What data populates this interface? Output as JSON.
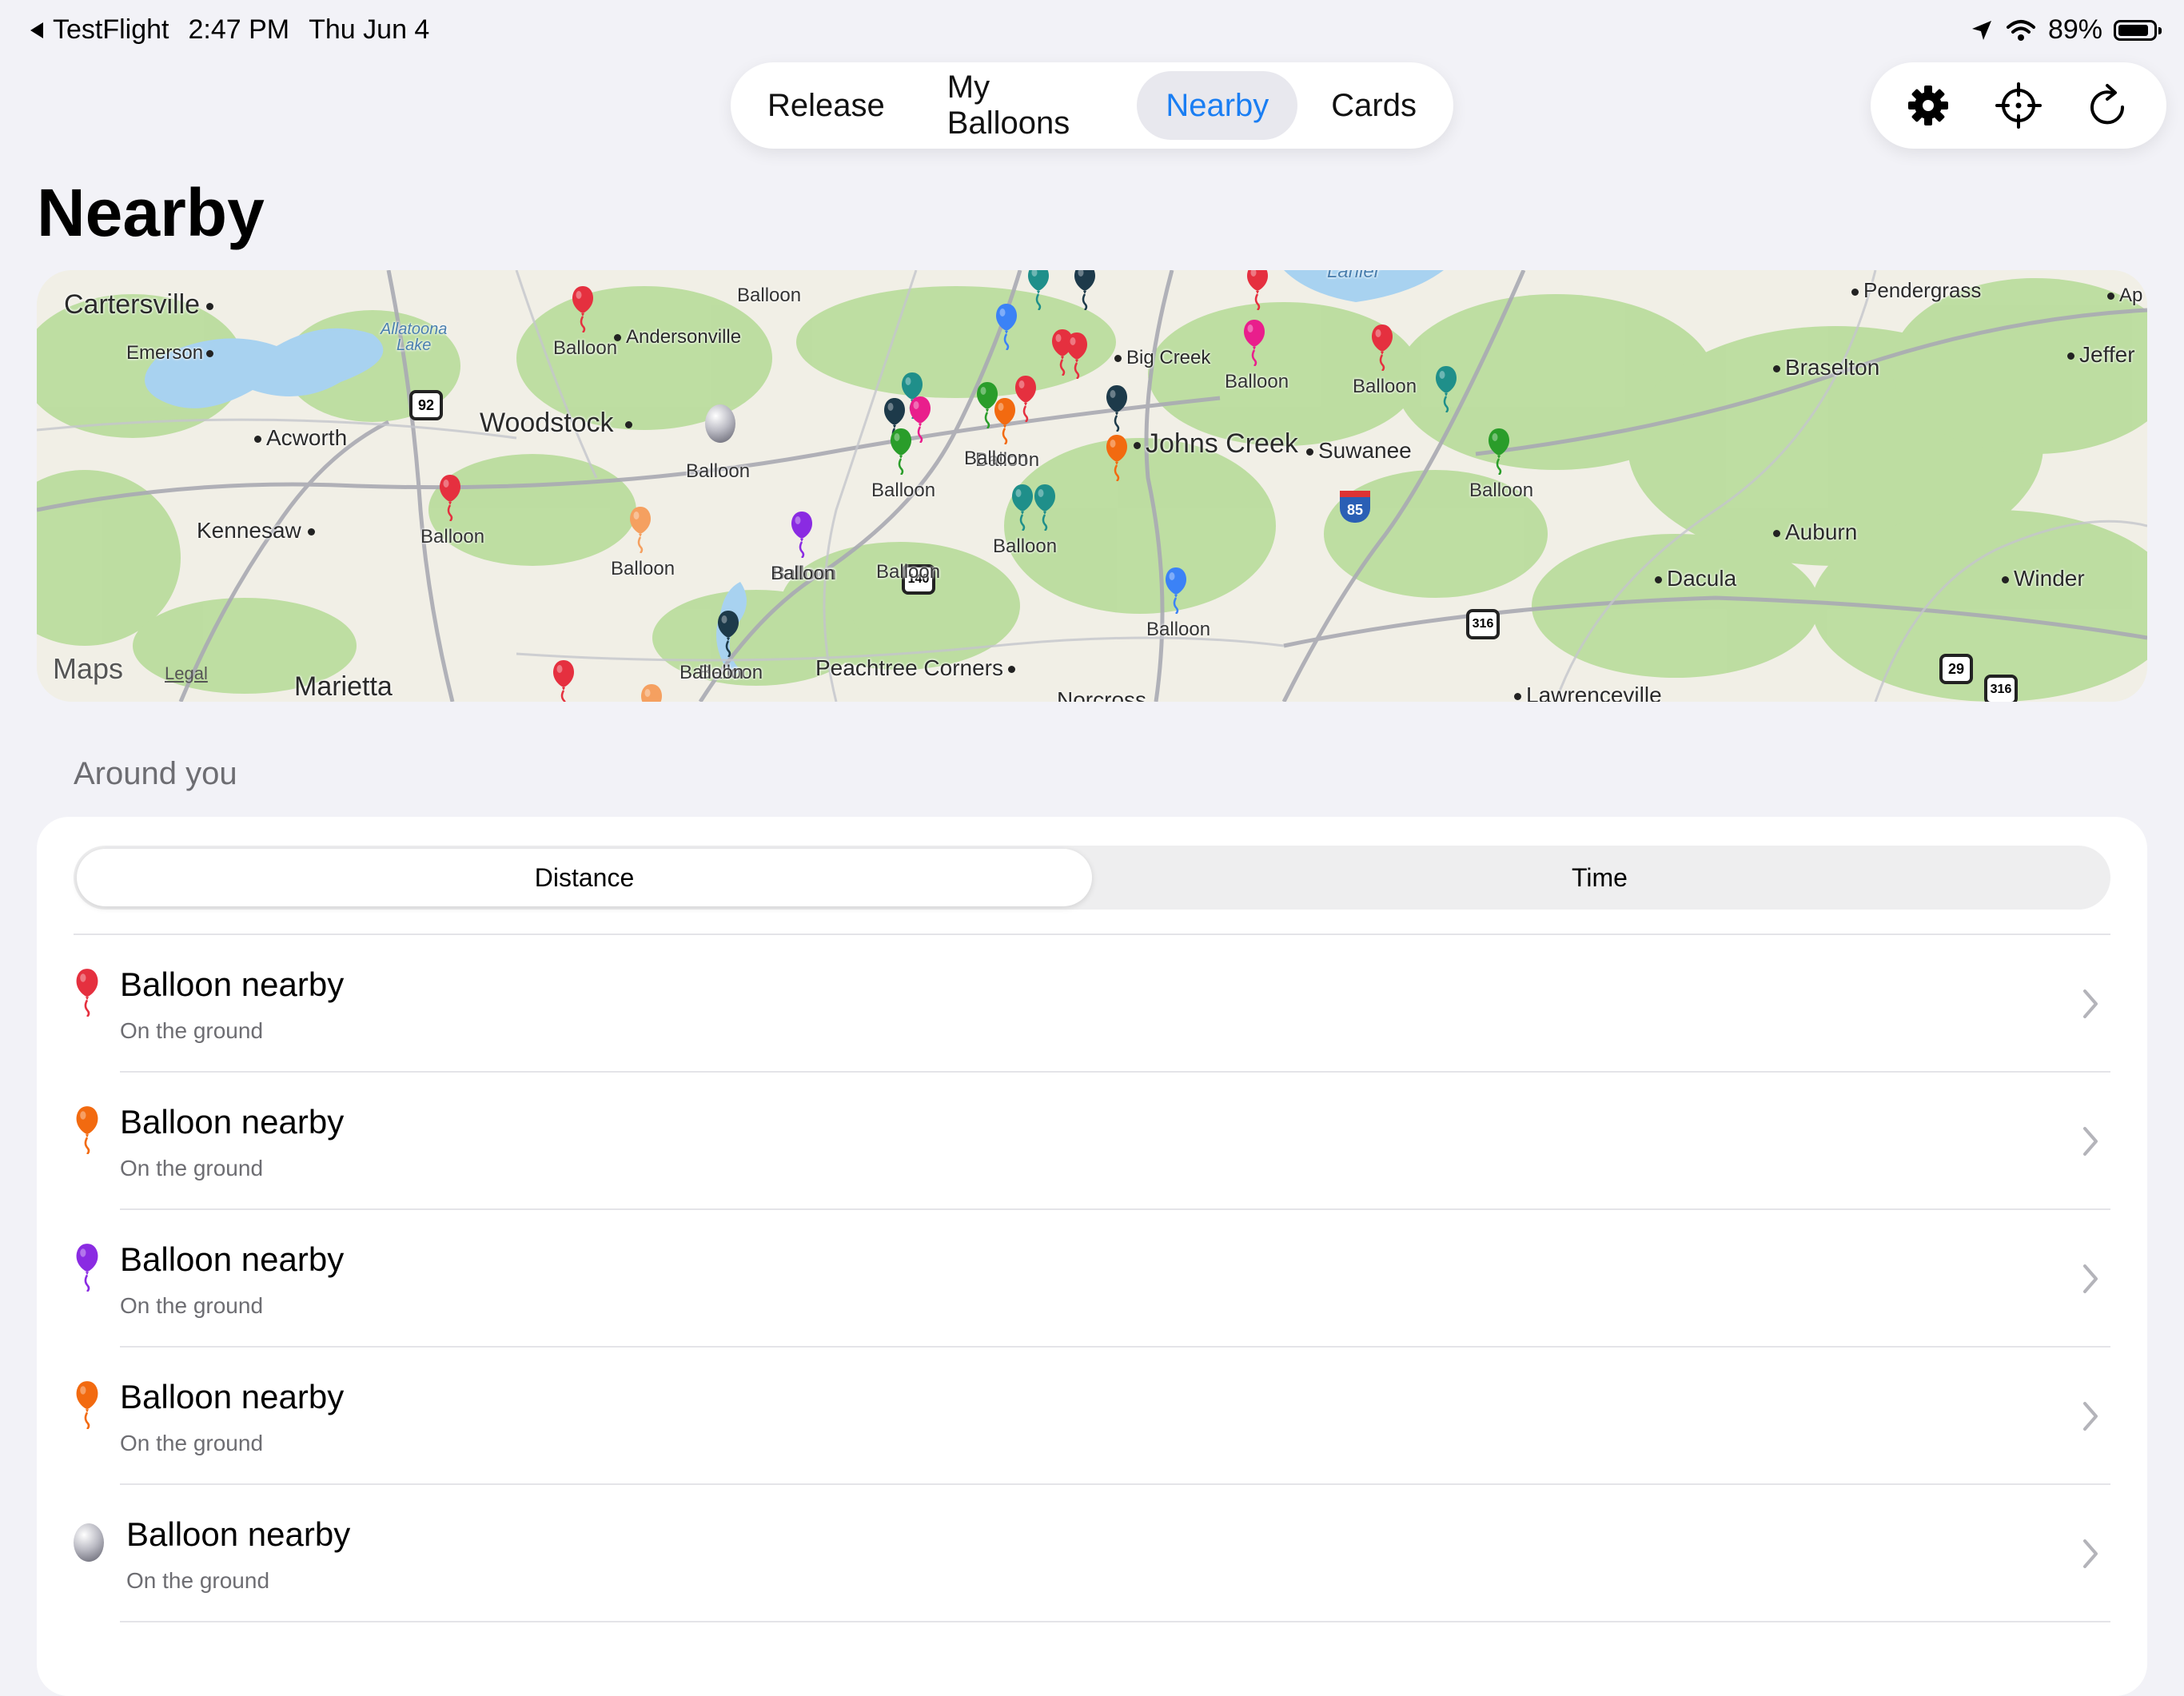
{
  "status_bar": {
    "back_app": "TestFlight",
    "time": "2:47 PM",
    "date": "Thu Jun 4",
    "battery": "89%",
    "battery_level": 0.89
  },
  "tabs": {
    "items": [
      "Release",
      "My Balloons",
      "Nearby",
      "Cards"
    ],
    "active": "Nearby"
  },
  "toolbar": {
    "settings_icon": "gear-icon",
    "locate_icon": "crosshair-icon",
    "refresh_icon": "refresh-icon"
  },
  "page": {
    "title": "Nearby"
  },
  "map": {
    "places": {
      "cartersville": "Cartersville",
      "emerson": "Emerson",
      "allatoona": "Allatoona\nLake",
      "andersonville": "Andersonville",
      "woodstock": "Woodstock",
      "acworth": "Acworth",
      "kennesaw": "Kennesaw",
      "marietta": "Marietta",
      "big_creek": "Big Creek",
      "johns_creek": "Johns Creek",
      "suwanee": "Suwanee",
      "pendergrass": "Pendergrass",
      "braselton": "Braselton",
      "jefferson": "Jeffer",
      "ap": "Ap",
      "auburn": "Auburn",
      "dacula": "Dacula",
      "winder": "Winder",
      "peachtree_corners": "Peachtree Corners",
      "lanier": "Lanier",
      "norcross": "Norcross",
      "lawrenceville": "Lawrenceville"
    },
    "balloon_label": "Balloon",
    "shields": {
      "s92": "92",
      "s140": "140",
      "s316a": "316",
      "s316b": "316",
      "s29": "29",
      "i85": "85"
    },
    "logo": "Maps",
    "legal": "Legal"
  },
  "list": {
    "section_label": "Around you",
    "sort_options": [
      "Distance",
      "Time"
    ],
    "selected_sort": "Distance",
    "items": [
      {
        "title": "Balloon nearby",
        "subtitle": "On the ground",
        "color": "#e5303f"
      },
      {
        "title": "Balloon nearby",
        "subtitle": "On the ground",
        "color": "#f26a10"
      },
      {
        "title": "Balloon nearby",
        "subtitle": "On the ground",
        "color": "#8a2be2"
      },
      {
        "title": "Balloon nearby",
        "subtitle": "On the ground",
        "color": "#f26a10"
      },
      {
        "title": "Balloon nearby",
        "subtitle": "On the ground",
        "color": "silver"
      }
    ]
  },
  "colors": {
    "accent": "#1a7ef3",
    "background": "#f2f2f7"
  }
}
